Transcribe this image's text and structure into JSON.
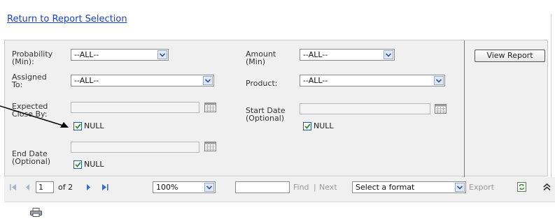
{
  "return_link": "Return to Report Selection",
  "filters": {
    "probability": {
      "label": "Probability\n(Min):",
      "value": "--ALL--"
    },
    "amount": {
      "label": "Amount\n(Min)",
      "value": "--ALL--"
    },
    "assigned_to": {
      "label": "Assigned\nTo:",
      "value": "--ALL--"
    },
    "product": {
      "label": "Product:",
      "value": "--ALL--"
    },
    "expected_close": {
      "label": "Expected\nClose By:",
      "value": "",
      "null_label": "NULL",
      "null_checked": true
    },
    "start_date": {
      "label": "Start Date\n(Optional)",
      "value": "",
      "null_label": "NULL",
      "null_checked": true
    },
    "end_date": {
      "label": "End Date\n(Optional)",
      "value": "",
      "null_label": "NULL",
      "null_checked": true
    }
  },
  "view_report_label": "View Report",
  "toolbar": {
    "page_current": "1",
    "page_of": "of 2",
    "zoom": "100%",
    "find_value": "",
    "find_label": "Find",
    "separator": "|",
    "next_label": "Next",
    "format": "Select a format",
    "export_label": "Export"
  },
  "colors": {
    "link": "#1a3fc8",
    "panel_bg": "#f0f0f0",
    "check": "#2e8b2e"
  }
}
